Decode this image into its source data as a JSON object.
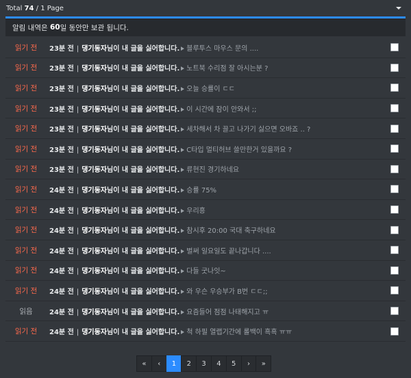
{
  "header": {
    "total_label": "Total",
    "total_count": "74",
    "page_info": "/ 1 Page"
  },
  "notice": {
    "prefix": "알림 내역은",
    "days": "60",
    "suffix": "일 동안만 보관 됩니다."
  },
  "notifications": [
    {
      "status": "읽기 전",
      "status_type": "unread",
      "time": "23분 전",
      "user": "댕기동자",
      "message": "님이 내 글을 싫어합니다.",
      "title": "블루투스 마우스 문의 ...."
    },
    {
      "status": "읽기 전",
      "status_type": "unread",
      "time": "23분 전",
      "user": "댕기동자",
      "message": "님이 내 글을 싫어합니다.",
      "title": "노트북 수리점 잘 아시는분 ?"
    },
    {
      "status": "읽기 전",
      "status_type": "unread",
      "time": "23분 전",
      "user": "댕기동자",
      "message": "님이 내 글을 싫어합니다.",
      "title": "오늘 승률이 ㄷㄷ"
    },
    {
      "status": "읽기 전",
      "status_type": "unread",
      "time": "23분 전",
      "user": "댕기동자",
      "message": "님이 내 글을 싫어합니다.",
      "title": "이 시간에 잠이 안와서 ;;"
    },
    {
      "status": "읽기 전",
      "status_type": "unread",
      "time": "23분 전",
      "user": "댕기동자",
      "message": "님이 내 글을 싫어합니다.",
      "title": "세차해서 차 끌고 나가기 싫으면 오바죠 .. ?"
    },
    {
      "status": "읽기 전",
      "status_type": "unread",
      "time": "23분 전",
      "user": "댕기동자",
      "message": "님이 내 글을 싫어합니다.",
      "title": "C타입 멀티허브 쓸만한거 있을까요 ?"
    },
    {
      "status": "읽기 전",
      "status_type": "unread",
      "time": "23분 전",
      "user": "댕기동자",
      "message": "님이 내 글을 싫어합니다.",
      "title": "류현진 경기하네요"
    },
    {
      "status": "읽기 전",
      "status_type": "unread",
      "time": "24분 전",
      "user": "댕기동자",
      "message": "님이 내 글을 싫어합니다.",
      "title": "승률 75%"
    },
    {
      "status": "읽기 전",
      "status_type": "unread",
      "time": "24분 전",
      "user": "댕기동자",
      "message": "님이 내 글을 싫어합니다.",
      "title": "우리흥"
    },
    {
      "status": "읽기 전",
      "status_type": "unread",
      "time": "24분 전",
      "user": "댕기동자",
      "message": "님이 내 글을 싫어합니다.",
      "title": "참시후 20:00 국대 축구하네요"
    },
    {
      "status": "읽기 전",
      "status_type": "unread",
      "time": "24분 전",
      "user": "댕기동자",
      "message": "님이 내 글을 싫어합니다.",
      "title": "벌써 일요일도 끝나갑니다 ...."
    },
    {
      "status": "읽기 전",
      "status_type": "unread",
      "time": "24분 전",
      "user": "댕기동자",
      "message": "님이 내 글을 싫어합니다.",
      "title": "다들 굿나잇~"
    },
    {
      "status": "읽기 전",
      "status_type": "unread",
      "time": "24분 전",
      "user": "댕기동자",
      "message": "님이 내 글을 싫어합니다.",
      "title": "와 우슨 우승부가 B번 ㄷㄷ;;"
    },
    {
      "status": "읽음",
      "status_type": "read",
      "time": "24분 전",
      "user": "댕기동자",
      "message": "님이 내 글을 싫어합니다.",
      "title": "요즘들어 점점 나태해지고 ㅠ"
    },
    {
      "status": "읽기 전",
      "status_type": "unread",
      "time": "24분 전",
      "user": "댕기동자",
      "message": "님이 내 글을 싫어합니다.",
      "title": "척 하필 열랩기간에 롤백이 흑흑 ㅠㅠ"
    }
  ],
  "pagination": {
    "first": "«",
    "prev": "‹",
    "pages": [
      "1",
      "2",
      "3",
      "4",
      "5"
    ],
    "current": "1",
    "next": "›",
    "last": "»"
  },
  "colors": {
    "accent": "#2c8cff",
    "unread": "#ff6a4d",
    "read": "#aeb2b7",
    "background": "#33373c"
  }
}
